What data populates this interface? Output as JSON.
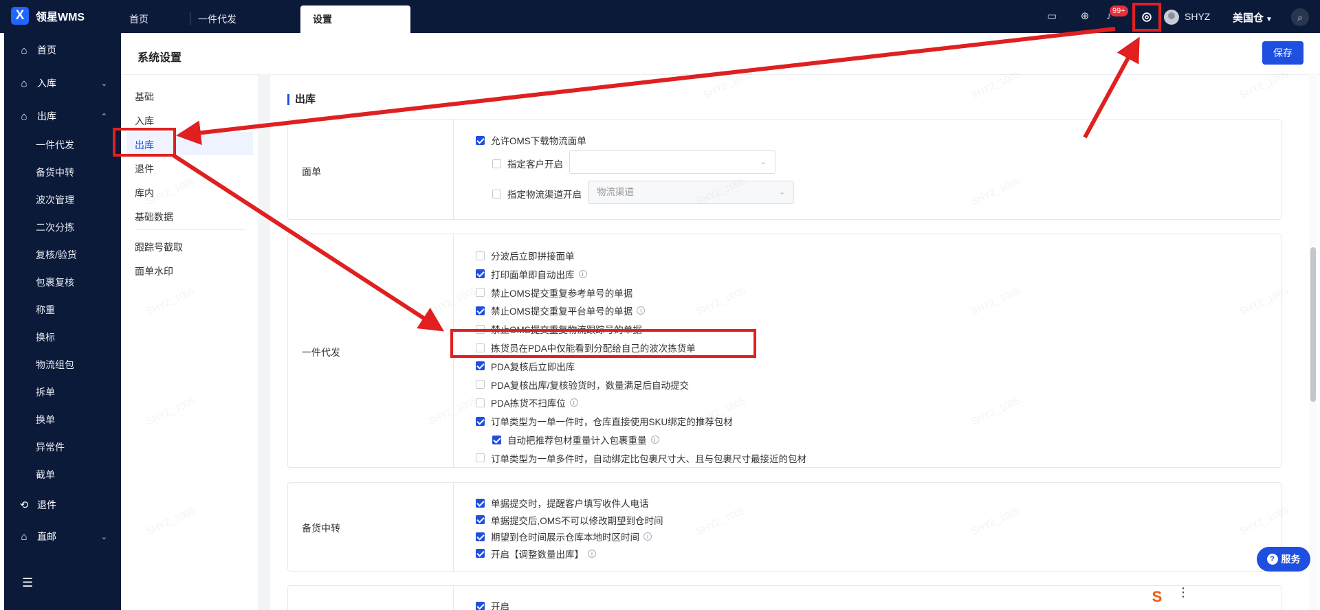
{
  "app": {
    "title": "领星WMS",
    "logo_glyph": "X"
  },
  "topbar": {
    "tabs": [
      {
        "label": "首页",
        "active": false
      },
      {
        "label": "一件代发",
        "active": false
      },
      {
        "label": "设置",
        "active": true
      }
    ],
    "notification_count": "99+",
    "user_name": "SHYZ",
    "warehouse": "美国仓"
  },
  "sidebar": {
    "items": [
      {
        "label": "首页",
        "icon": "home-icon"
      },
      {
        "label": "入库",
        "icon": "inbound-icon"
      },
      {
        "label": "出库",
        "icon": "outbound-icon"
      }
    ],
    "outbound_children": [
      "一件代发",
      "备货中转",
      "波次管理",
      "二次分拣",
      "复核/验货",
      "包裹复核",
      "称重",
      "换标",
      "物流组包",
      "拆单",
      "换单",
      "异常件",
      "截单"
    ],
    "bottom_items": [
      {
        "label": "退件",
        "icon": "return-icon"
      },
      {
        "label": "直邮",
        "icon": "direct-mail-icon"
      }
    ]
  },
  "page": {
    "title": "系统设置",
    "save_label": "保存"
  },
  "settings_menu": {
    "groups": [
      "基础",
      "入库",
      "出库",
      "退件",
      "库内",
      "基础数据"
    ],
    "extra": [
      "跟踪号截取",
      "面单水印"
    ],
    "active": "出库"
  },
  "content": {
    "section_title": "出库",
    "label_panel": {
      "label": "面单",
      "allow_oms_download": "允许OMS下载物流面单",
      "specify_customer": "指定客户开启",
      "specify_channel": "指定物流渠道开启",
      "channel_placeholder": "物流渠道"
    },
    "dropship_panel": {
      "label": "一件代发",
      "options": [
        {
          "text": "分波后立即拼接面单",
          "checked": false,
          "info": false
        },
        {
          "text": "打印面单即自动出库",
          "checked": true,
          "info": true
        },
        {
          "text": "禁止OMS提交重复参考单号的单据",
          "checked": false,
          "info": false
        },
        {
          "text": "禁止OMS提交重复平台单号的单据",
          "checked": true,
          "info": true
        },
        {
          "text": "禁止OMS提交重复物流跟踪号的单据",
          "checked": false,
          "info": false
        },
        {
          "text": "拣货员在PDA中仅能看到分配给自己的波次拣货单",
          "checked": false,
          "info": false
        },
        {
          "text": "PDA复核后立即出库",
          "checked": true,
          "info": false
        },
        {
          "text": "PDA复核出库/复核验货时，数量满足后自动提交",
          "checked": false,
          "info": false
        },
        {
          "text": "PDA拣货不扫库位",
          "checked": false,
          "info": true
        },
        {
          "text": "订单类型为一单一件时，仓库直接使用SKU绑定的推荐包材",
          "checked": true,
          "info": false
        },
        {
          "text": "自动把推荐包材重量计入包裹重量",
          "checked": true,
          "info": true
        },
        {
          "text": "订单类型为一单多件时，自动绑定比包裹尺寸大、且与包裹尺寸最接近的包材",
          "checked": false,
          "info": false
        }
      ]
    },
    "transfer_panel": {
      "label": "备货中转",
      "options": [
        {
          "text": "单据提交时，提醒客户填写收件人电话",
          "checked": true,
          "info": false
        },
        {
          "text": "单据提交后,OMS不可以修改期望到仓时间",
          "checked": true,
          "info": false
        },
        {
          "text": "期望到仓时间展示仓库本地时区时间",
          "checked": true,
          "info": true
        },
        {
          "text": "开启【调整数量出库】",
          "checked": true,
          "info": true
        }
      ]
    },
    "bottom_panel": {
      "option": "开启"
    }
  },
  "service_label": "服务",
  "watermark_text": "SHYZ_1005",
  "colors": {
    "accent": "#1f4fe0",
    "topbar": "#0c1a3a",
    "highlight": "#e02020"
  }
}
